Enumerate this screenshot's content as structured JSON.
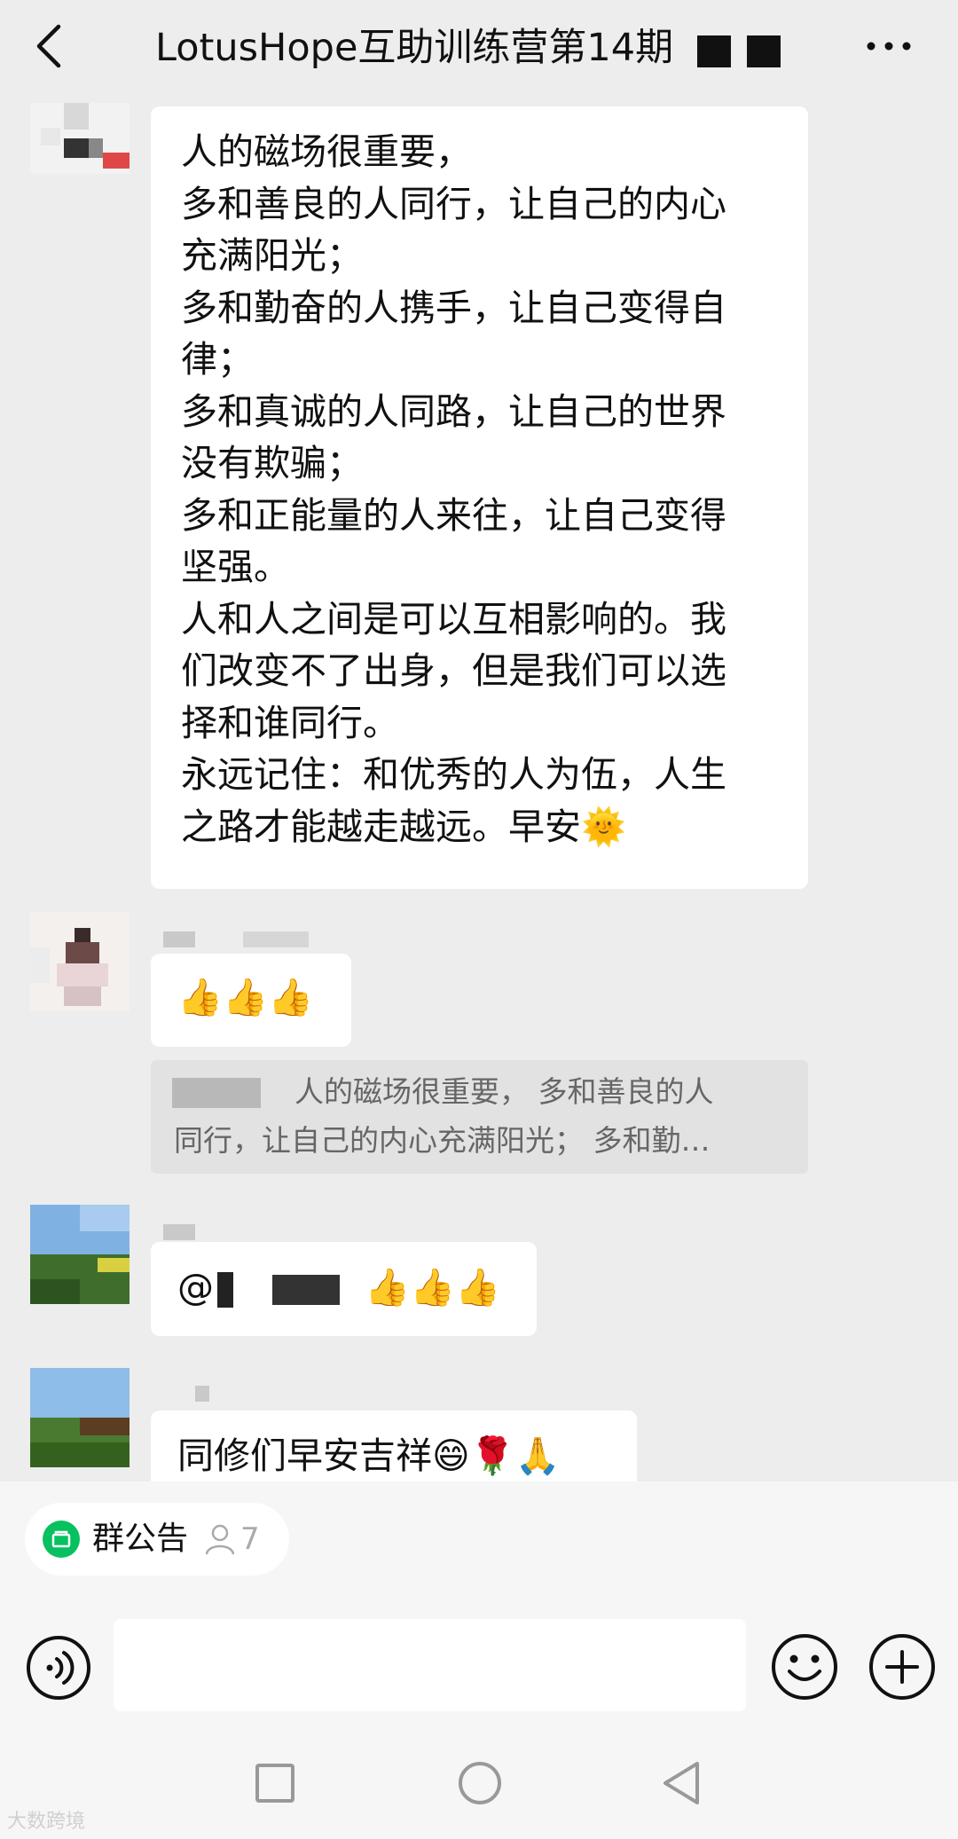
{
  "header": {
    "title": "LotusHope互助训练营第14期",
    "back_icon": "chevron-left-icon",
    "more_icon": "more-dots-icon"
  },
  "messages": [
    {
      "lines": [
        "人的磁场很重要，",
        "多和善良的人同行，让自己的内心",
        "充满阳光；",
        "多和勤奋的人携手，让自己变得自",
        "律；",
        "多和真诚的人同路，让自己的世界",
        "没有欺骗；",
        "多和正能量的人来往，让自己变得",
        "坚强。",
        "人和人之间是可以互相影响的。我",
        "们改变不了出身，但是我们可以选",
        "择和谁同行。",
        "永远记住：和优秀的人为伍，人生",
        "之路才能越走越远。早安🌞"
      ]
    },
    {
      "text": "👍👍👍",
      "quote_lines": [
        "人的磁场很重要， 多和善良的人",
        "同行，让自己的内心充满阳光； 多和勤…"
      ]
    },
    {
      "text": "@",
      "emojis": "👍👍👍"
    },
    {
      "text": "同修们早安吉祥😄🌹🙏"
    }
  ],
  "notice": {
    "label": "群公告",
    "count": "7",
    "icon": "notice-icon",
    "person_icon": "person-icon"
  },
  "input": {
    "value": "",
    "voice_icon": "voice-icon",
    "emoji_icon": "emoji-icon",
    "plus_icon": "plus-icon"
  },
  "navbar": {
    "square_icon": "recent-apps-icon",
    "circle_icon": "home-icon",
    "back_icon": "back-triangle-icon"
  },
  "watermark": "大数跨境",
  "colors": {
    "background": "#ededed",
    "bubble": "#ffffff",
    "quote": "#e2e2e2",
    "accent": "#07c160"
  }
}
